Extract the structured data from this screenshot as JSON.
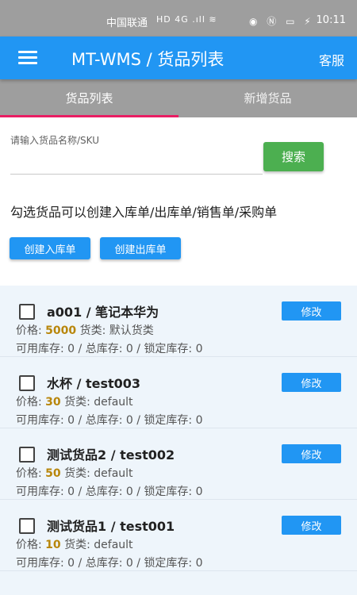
{
  "status_bar": {
    "carrier": "中国联通",
    "signal": "HD 4G .ıll ≋",
    "icons": "◉ Ⓝ ▭ ⚡",
    "time": "10:11"
  },
  "app_bar": {
    "title": "MT-WMS / 货品列表",
    "service_label": "客服"
  },
  "tabs": [
    {
      "label": "货品列表",
      "active": true
    },
    {
      "label": "新增货品",
      "active": false
    }
  ],
  "search": {
    "label": "请输入货品名称/SKU",
    "value": "",
    "button_label": "搜索"
  },
  "hint": "勾选货品可以创建入库单/出库单/销售单/采购单",
  "actions": {
    "create_inbound": "创建入库单",
    "create_outbound": "创建出库单"
  },
  "labels": {
    "price": "价格:",
    "category": "货类:",
    "available_stock": "可用库存:",
    "total_stock": "总库存:",
    "locked_stock": "锁定库存:",
    "separator": "/",
    "edit": "修改"
  },
  "items": [
    {
      "name": "a001 / 笔记本华为",
      "price": "5000",
      "category": "默认货类",
      "available": "0",
      "total": "0",
      "locked": "0"
    },
    {
      "name": "水杯 / test003",
      "price": "30",
      "category": "default",
      "available": "0",
      "total": "0",
      "locked": "0"
    },
    {
      "name": "测试货品2 / test002",
      "price": "50",
      "category": "default",
      "available": "0",
      "total": "0",
      "locked": "0"
    },
    {
      "name": "测试货品1 / test001",
      "price": "10",
      "category": "default",
      "available": "0",
      "total": "0",
      "locked": "0"
    }
  ],
  "colors": {
    "primary": "#2196f3",
    "search_button": "#4caf50",
    "tab_indicator": "#e91e63",
    "price_text": "#b8860b"
  }
}
